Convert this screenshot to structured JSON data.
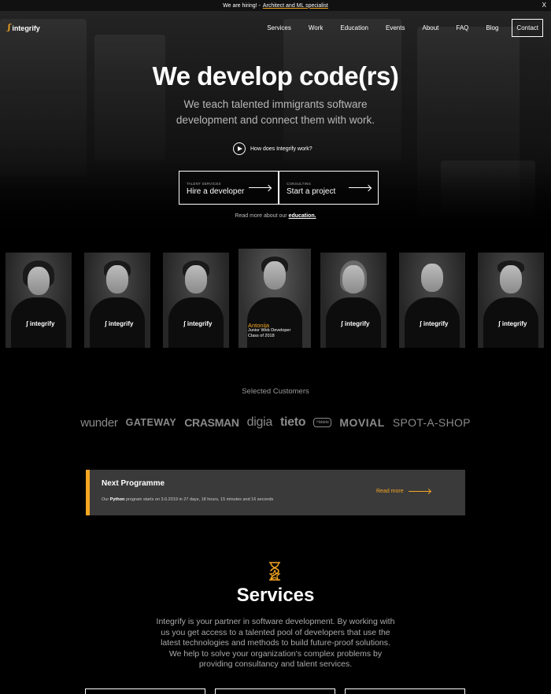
{
  "announcement": {
    "text": "We are hiring! -",
    "link": "Architect and ML specialist",
    "close": "X"
  },
  "brand": {
    "mark": "ʃ",
    "name": "integrify"
  },
  "nav": {
    "items": [
      "Services",
      "Work",
      "Education",
      "Events",
      "About",
      "FAQ",
      "Blog"
    ],
    "contact": "Contact"
  },
  "hero": {
    "headline": "We develop code(rs)",
    "subheadline": "We teach talented immigrants software development and connect them with work.",
    "video_link": "How does Integrify work?",
    "ctas": [
      {
        "small": "TALENT SERVICES",
        "label": "Hire a developer"
      },
      {
        "small": "CONSULTING",
        "label": "Start a project"
      }
    ],
    "read_more_prefix": "Read more about our",
    "read_more_link": "education."
  },
  "people": {
    "shirt_text": "ʃ integrify",
    "featured": {
      "name": "Antonija",
      "role": "Junior Web Developer",
      "class": "Class of 2018"
    }
  },
  "customers": {
    "title": "Selected Customers",
    "logos": [
      "wunder",
      "GATEWAY",
      "CRASMAN",
      "digia",
      "tieto",
      "Helsinki",
      "MOVIAL",
      "SPOT-A-SHOP"
    ]
  },
  "programme": {
    "title": "Next Programme",
    "prefix": "Our",
    "language": "Python",
    "suffix": "program starts on 3.6.2019 in 27 days, 18 hours, 15 minutes and 16 seconds",
    "read_more": "Read more"
  },
  "services": {
    "title": "Services",
    "text": "Integrify is your partner in software development. By working with us you get access to a talented pool of developers that use the latest technologies and methods to build future-proof solutions. We help to solve your organization's complex problems by providing consultancy and talent services."
  },
  "colors": {
    "accent": "#f5a623",
    "background": "#000000",
    "panel": "#3a3a3a"
  }
}
